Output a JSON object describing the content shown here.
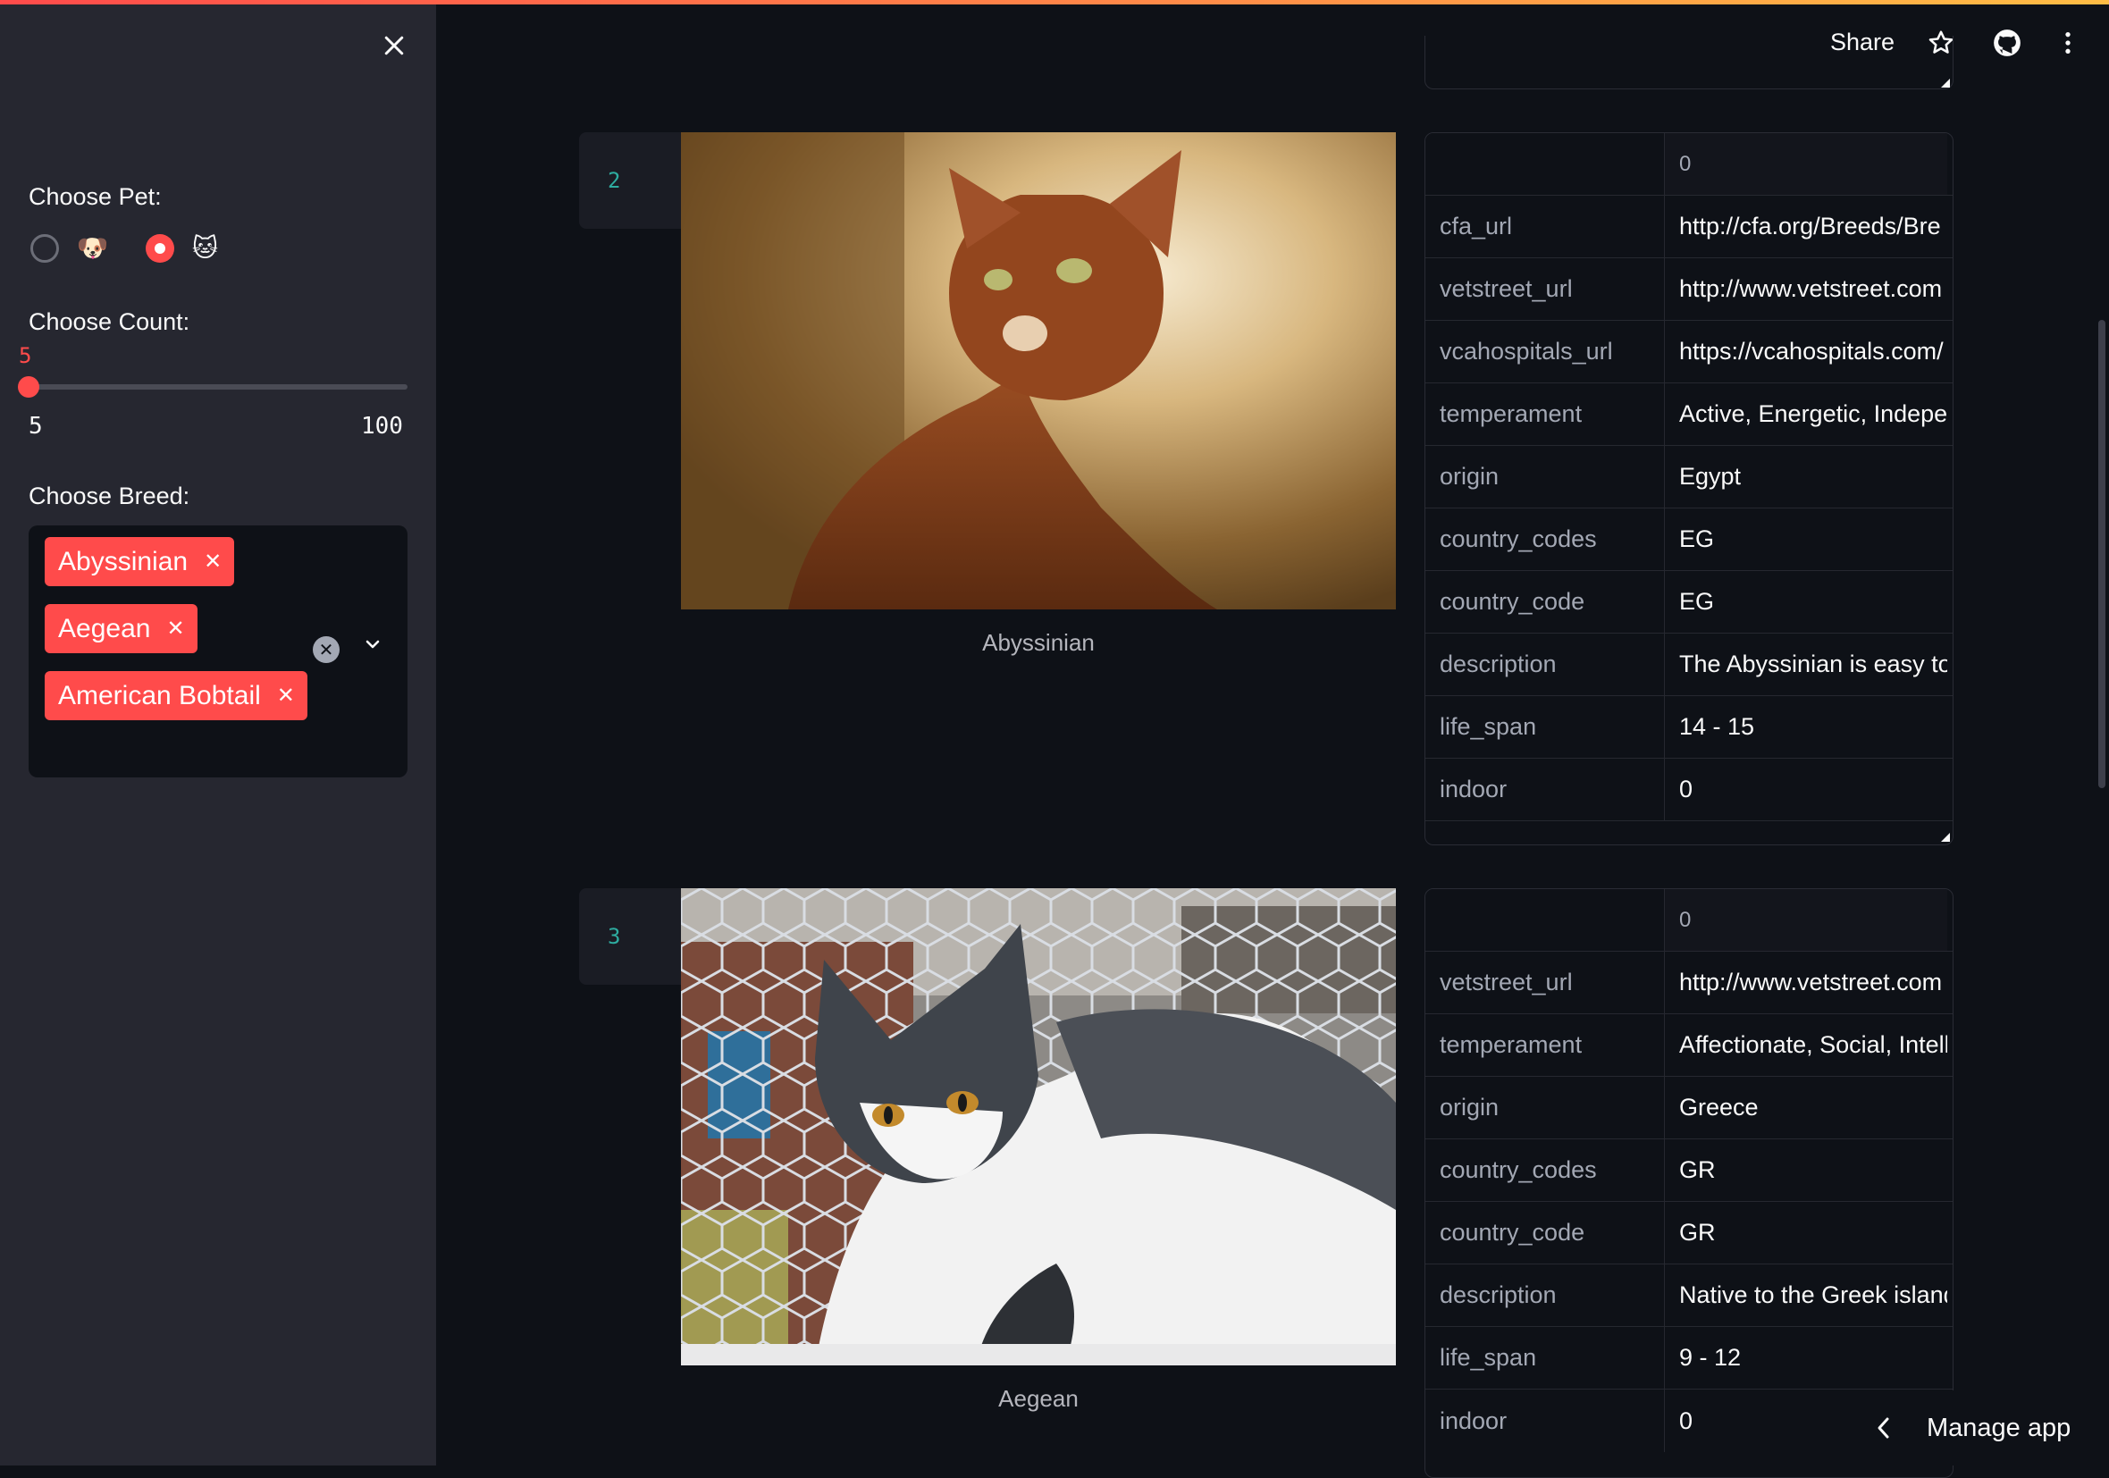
{
  "header": {
    "share_label": "Share",
    "icons": [
      "star-icon",
      "github-icon",
      "more-vert-icon"
    ]
  },
  "sidebar": {
    "pet_label": "Choose Pet:",
    "pet_options": [
      {
        "emoji": "🐶",
        "selected": false
      },
      {
        "emoji": "🐱",
        "selected": true
      }
    ],
    "count_label": "Choose Count:",
    "count_value": "5",
    "count_min": "5",
    "count_max": "100",
    "count_fraction": 0,
    "breed_label": "Choose Breed:",
    "breeds": [
      "Abyssinian",
      "Aegean",
      "American Bobtail"
    ],
    "tag_remove": "✕",
    "clear_glyph": "✕"
  },
  "rows": [
    {
      "index": "2",
      "caption": "Abyssinian",
      "col_header": "0",
      "fields": [
        {
          "key": "cfa_url",
          "value": "http://cfa.org/Breeds/Bre"
        },
        {
          "key": "vetstreet_url",
          "value": "http://www.vetstreet.com"
        },
        {
          "key": "vcahospitals_url",
          "value": "https://vcahospitals.com/"
        },
        {
          "key": "temperament",
          "value": "Active, Energetic, Indeper"
        },
        {
          "key": "origin",
          "value": "Egypt"
        },
        {
          "key": "country_codes",
          "value": "EG"
        },
        {
          "key": "country_code",
          "value": "EG"
        },
        {
          "key": "description",
          "value": "The Abyssinian is easy to c"
        },
        {
          "key": "life_span",
          "value": "14 - 15"
        },
        {
          "key": "indoor",
          "value": "0"
        }
      ]
    },
    {
      "index": "3",
      "caption": "Aegean",
      "col_header": "0",
      "fields": [
        {
          "key": "vetstreet_url",
          "value": "http://www.vetstreet.com"
        },
        {
          "key": "temperament",
          "value": "Affectionate, Social, Intell"
        },
        {
          "key": "origin",
          "value": "Greece"
        },
        {
          "key": "country_codes",
          "value": "GR"
        },
        {
          "key": "country_code",
          "value": "GR"
        },
        {
          "key": "description",
          "value": "Native to the Greek island"
        },
        {
          "key": "life_span",
          "value": "9 - 12"
        },
        {
          "key": "indoor",
          "value": "0"
        }
      ]
    }
  ],
  "manage_app_label": "Manage app",
  "colors": {
    "accent": "#ff4b4b",
    "sidebar_bg": "#262730",
    "main_bg": "#0e1117",
    "index_teal": "#2eaca0"
  }
}
